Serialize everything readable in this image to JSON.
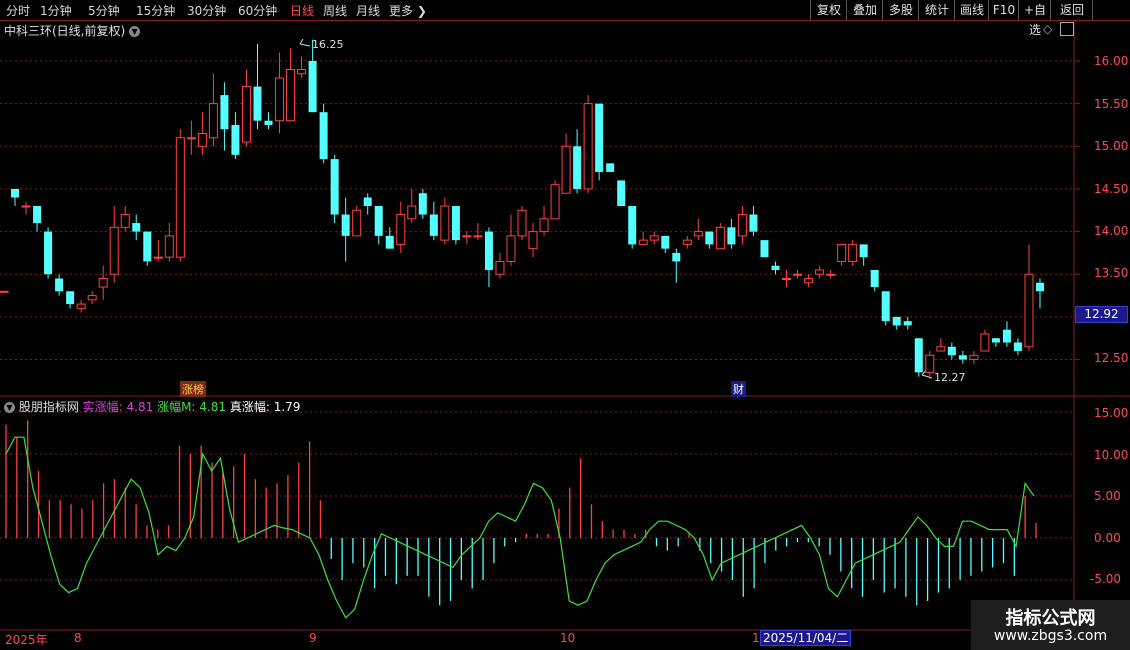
{
  "toolbar": {
    "periods": [
      "分时",
      "1分钟",
      "5分钟",
      "15分钟",
      "30分钟",
      "60分钟",
      "日线",
      "周线",
      "月线",
      "更多"
    ],
    "active_period": "日线",
    "right_buttons": [
      "复权",
      "叠加",
      "多股",
      "统计",
      "画线",
      "F10",
      "+自选",
      "返回"
    ]
  },
  "stock": {
    "title": "中科三环(日线,前复权)",
    "current_price_tag": "12.92",
    "high_label": "16.25",
    "low_label": "12.27",
    "markers": [
      "涨榜",
      "财"
    ]
  },
  "indicator": {
    "name": "股朋指标网",
    "items": [
      {
        "label": "实涨幅: 4.81",
        "color": "#e040e0"
      },
      {
        "label": "涨幅M: 4.81",
        "color": "#3ee03e"
      },
      {
        "label": "真涨幅: 1.79",
        "color": "#ffffff"
      }
    ]
  },
  "dates": [
    "2025年",
    "8",
    "9",
    "10",
    "1",
    "2025/11/04/二"
  ],
  "watermark": {
    "title": "指标公式网",
    "url": "www.zbgs3.com"
  },
  "colors": {
    "up": "#ff4040",
    "down": "#54ffff",
    "grid": "#8a1c1c",
    "line": "#3ee03e"
  },
  "chart_data": [
    {
      "type": "candlestick",
      "ylim": [
        12.2,
        16.3
      ],
      "yticks": [
        "16.00",
        "15.50",
        "15.00",
        "14.50",
        "14.00",
        "13.50",
        "13.00",
        "12.50"
      ],
      "candles": [
        [
          13.3,
          13.3,
          13.3,
          13.3
        ],
        [
          14.5,
          14.4,
          14.5,
          14.3
        ],
        [
          14.3,
          14.3,
          14.35,
          14.2
        ],
        [
          14.3,
          14.1,
          14.3,
          14.0
        ],
        [
          14.0,
          13.5,
          14.05,
          13.45
        ],
        [
          13.45,
          13.3,
          13.5,
          13.25
        ],
        [
          13.3,
          13.15,
          13.3,
          13.1
        ],
        [
          13.1,
          13.15,
          13.2,
          13.05
        ],
        [
          13.2,
          13.25,
          13.3,
          13.15
        ],
        [
          13.35,
          13.45,
          13.6,
          13.2
        ],
        [
          13.5,
          14.05,
          14.3,
          13.4
        ],
        [
          14.05,
          14.2,
          14.3,
          14.0
        ],
        [
          14.1,
          14.0,
          14.2,
          13.9
        ],
        [
          14.0,
          13.65,
          14.0,
          13.6
        ],
        [
          13.7,
          13.7,
          13.9,
          13.65
        ],
        [
          13.7,
          13.95,
          14.1,
          13.65
        ],
        [
          13.7,
          15.1,
          15.2,
          13.65
        ],
        [
          15.1,
          15.1,
          15.3,
          14.9
        ],
        [
          15.0,
          15.15,
          15.4,
          14.9
        ],
        [
          15.1,
          15.5,
          15.85,
          15.0
        ],
        [
          15.6,
          15.2,
          15.75,
          14.95
        ],
        [
          15.25,
          14.9,
          15.4,
          14.85
        ],
        [
          15.05,
          15.7,
          15.9,
          15.0
        ],
        [
          15.7,
          15.3,
          16.2,
          15.2
        ],
        [
          15.3,
          15.25,
          15.4,
          15.2
        ],
        [
          15.3,
          15.8,
          16.1,
          15.15
        ],
        [
          15.3,
          15.9,
          16.15,
          15.3
        ],
        [
          15.85,
          15.9,
          16.05,
          15.8
        ],
        [
          16.0,
          15.4,
          16.25,
          15.4
        ],
        [
          15.4,
          14.85,
          15.5,
          14.8
        ],
        [
          14.85,
          14.2,
          14.9,
          14.1
        ],
        [
          14.2,
          13.95,
          14.4,
          13.65
        ],
        [
          13.95,
          14.25,
          14.3,
          13.95
        ],
        [
          14.4,
          14.3,
          14.45,
          14.2
        ],
        [
          14.3,
          13.95,
          14.3,
          13.85
        ],
        [
          13.95,
          13.8,
          14.05,
          13.8
        ],
        [
          13.85,
          14.2,
          14.35,
          13.75
        ],
        [
          14.15,
          14.3,
          14.5,
          14.1
        ],
        [
          14.45,
          14.2,
          14.5,
          14.15
        ],
        [
          14.2,
          13.95,
          14.35,
          13.9
        ],
        [
          13.9,
          14.3,
          14.4,
          13.85
        ],
        [
          14.3,
          13.9,
          14.3,
          13.85
        ],
        [
          13.95,
          13.95,
          14.0,
          13.85
        ],
        [
          13.95,
          13.95,
          14.1,
          13.9
        ],
        [
          14.0,
          13.55,
          14.05,
          13.35
        ],
        [
          13.5,
          13.65,
          13.75,
          13.45
        ],
        [
          13.65,
          13.95,
          14.2,
          13.6
        ],
        [
          13.95,
          14.25,
          14.3,
          13.9
        ],
        [
          13.8,
          14.0,
          14.1,
          13.7
        ],
        [
          14.0,
          14.15,
          14.3,
          13.95
        ],
        [
          14.15,
          14.55,
          14.6,
          14.15
        ],
        [
          14.45,
          15.0,
          15.15,
          14.5
        ],
        [
          15.0,
          14.5,
          15.2,
          14.45
        ],
        [
          14.5,
          15.5,
          15.6,
          14.45
        ],
        [
          15.5,
          14.7,
          15.5,
          14.6
        ],
        [
          14.8,
          14.7,
          14.8,
          14.7
        ],
        [
          14.6,
          14.3,
          14.6,
          14.3
        ],
        [
          14.3,
          13.85,
          14.3,
          13.8
        ],
        [
          13.85,
          13.9,
          14.0,
          13.85
        ],
        [
          13.9,
          13.95,
          14.0,
          13.85
        ],
        [
          13.95,
          13.8,
          13.95,
          13.75
        ],
        [
          13.75,
          13.65,
          13.8,
          13.4
        ],
        [
          13.85,
          13.9,
          13.95,
          13.8
        ],
        [
          13.95,
          14.0,
          14.15,
          13.9
        ],
        [
          14.0,
          13.85,
          14.0,
          13.8
        ],
        [
          13.8,
          14.05,
          14.1,
          13.8
        ],
        [
          14.05,
          13.85,
          14.15,
          13.8
        ],
        [
          13.95,
          14.2,
          14.3,
          13.85
        ],
        [
          14.2,
          14.0,
          14.3,
          13.95
        ],
        [
          13.9,
          13.7,
          13.9,
          13.7
        ],
        [
          13.6,
          13.55,
          13.65,
          13.5
        ],
        [
          13.45,
          13.45,
          13.55,
          13.35
        ],
        [
          13.5,
          13.5,
          13.55,
          13.45
        ],
        [
          13.4,
          13.45,
          13.5,
          13.35
        ],
        [
          13.5,
          13.55,
          13.6,
          13.45
        ],
        [
          13.5,
          13.5,
          13.55,
          13.45
        ],
        [
          13.65,
          13.85,
          13.85,
          13.6
        ],
        [
          13.65,
          13.85,
          13.9,
          13.6
        ],
        [
          13.85,
          13.7,
          13.85,
          13.6
        ],
        [
          13.55,
          13.35,
          13.55,
          13.3
        ],
        [
          13.3,
          12.95,
          13.3,
          12.9
        ],
        [
          13.0,
          12.9,
          13.0,
          12.85
        ],
        [
          12.95,
          12.9,
          13.0,
          12.85
        ],
        [
          12.75,
          12.35,
          12.75,
          12.3
        ],
        [
          12.35,
          12.55,
          12.6,
          12.27
        ],
        [
          12.6,
          12.65,
          12.75,
          12.6
        ],
        [
          12.65,
          12.55,
          12.7,
          12.5
        ],
        [
          12.55,
          12.5,
          12.6,
          12.45
        ],
        [
          12.5,
          12.55,
          12.6,
          12.45
        ],
        [
          12.6,
          12.8,
          12.85,
          12.6
        ],
        [
          12.75,
          12.7,
          12.75,
          12.65
        ],
        [
          12.85,
          12.7,
          12.95,
          12.65
        ],
        [
          12.7,
          12.6,
          12.75,
          12.55
        ],
        [
          12.65,
          13.5,
          13.85,
          12.6
        ],
        [
          13.4,
          13.3,
          13.45,
          13.1
        ]
      ]
    },
    {
      "type": "bar+line",
      "ylim": [
        -10,
        17
      ],
      "yticks": [
        "15.00",
        "10.00",
        "5.00",
        "0.00",
        "-5.00"
      ],
      "bars": [
        13.5,
        12,
        14,
        8,
        4.5,
        4.5,
        4,
        3.5,
        4.5,
        6.5,
        7,
        6,
        4,
        1.5,
        1,
        1.5,
        11,
        10,
        11,
        9,
        8,
        8.5,
        10,
        7,
        6,
        6.5,
        7.5,
        9,
        11.5,
        4.5,
        -2.5,
        -5,
        -3,
        -3.5,
        -6,
        -4.5,
        -5.5,
        -4.5,
        -4.5,
        -7,
        -8,
        -7.5,
        -5,
        -6,
        -5,
        -3,
        -1,
        -0.5,
        0.5,
        0.5,
        0.5,
        3.5,
        6,
        9.5,
        4,
        2,
        1,
        1,
        0.5,
        1,
        -1,
        -1.5,
        -1,
        0.5,
        -1.5,
        -3,
        -4,
        -5,
        -7,
        -6,
        -3,
        -1.5,
        -1,
        -0.5,
        -0.5,
        -1,
        -2,
        -4,
        -6,
        -7,
        -5,
        -6.5,
        -6,
        -7,
        -8,
        -7.5,
        -6.5,
        -6,
        -5,
        -4.5,
        -4,
        -3.5,
        -3,
        -4.5,
        5,
        1.8
      ],
      "line": [
        10,
        12,
        12,
        6,
        2,
        -2,
        -5.5,
        -6.5,
        -6,
        -3,
        -1,
        1,
        3,
        5,
        7,
        6,
        3,
        -2,
        -1,
        -1.5,
        0,
        2.5,
        10,
        8,
        9.5,
        3.5,
        -0.5,
        0,
        0.5,
        1,
        1.5,
        1.2,
        1,
        0.5,
        0,
        -2,
        -5,
        -7.5,
        -9.5,
        -8.5,
        -5,
        -2,
        0.5,
        0,
        -0.5,
        -1,
        -1.5,
        -2,
        -2.5,
        -3,
        -3.5,
        -2,
        -1,
        0,
        2,
        3,
        2.5,
        2,
        4,
        6.5,
        6,
        4.5,
        0,
        -7.5,
        -8,
        -7.5,
        -5,
        -3,
        -2,
        -1.5,
        -1,
        -0.5,
        1,
        2,
        2,
        1.5,
        1,
        0,
        -2,
        -5,
        -3,
        -2.5,
        -2,
        -1.5,
        -1,
        -0.5,
        0,
        0.5,
        1,
        1.5,
        0,
        -2,
        -6,
        -7,
        -5,
        -3,
        -2.5,
        -2,
        -1.5,
        -1,
        -0.5,
        1,
        2.5,
        1.5,
        0,
        -1,
        -1,
        2,
        2,
        1.5,
        1,
        1,
        1,
        -1,
        6.5,
        5
      ],
      "series": [
        {
          "name": "实涨幅"
        },
        {
          "name": "涨幅M"
        },
        {
          "name": "真涨幅"
        }
      ]
    }
  ]
}
